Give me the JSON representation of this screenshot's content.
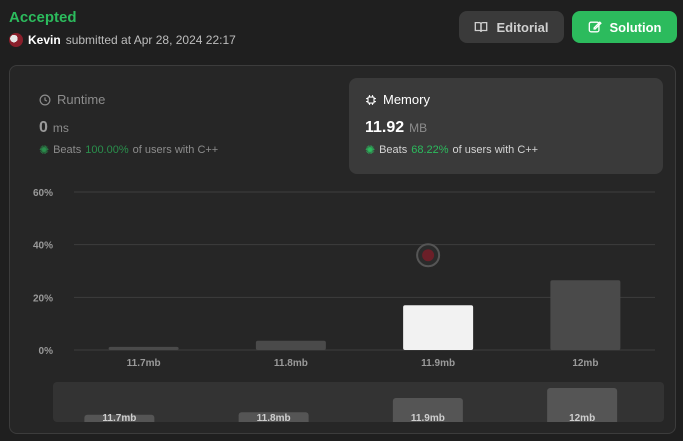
{
  "header": {
    "status": "Accepted",
    "username": "Kevin",
    "submitted_text": "submitted at Apr 28, 2024 22:17",
    "editorial_label": "Editorial",
    "solution_label": "Solution"
  },
  "runtime": {
    "title": "Runtime",
    "value": "0",
    "unit": "ms",
    "beats_label": "Beats",
    "beats_pct": "100.00%",
    "beats_suffix": "of users with C++"
  },
  "memory": {
    "title": "Memory",
    "value": "11.92",
    "unit": "MB",
    "beats_label": "Beats",
    "beats_pct": "68.22%",
    "beats_suffix": "of users with C++"
  },
  "colors": {
    "accent": "#2cbb5d",
    "bar_default": "#4a4a4a",
    "bar_selected": "#f2f2f2"
  },
  "chart_data": {
    "type": "bar",
    "categories": [
      "11.7mb",
      "11.8mb",
      "11.9mb",
      "12mb"
    ],
    "values": [
      1.2,
      3.5,
      17.0,
      26.5
    ],
    "selected_index": 2,
    "ylim": [
      0,
      60
    ],
    "yticks": [
      "0%",
      "20%",
      "40%",
      "60%"
    ],
    "grid": true
  },
  "minimap": {
    "labels": [
      "11.7mb",
      "11.8mb",
      "11.9mb",
      "12mb"
    ]
  }
}
